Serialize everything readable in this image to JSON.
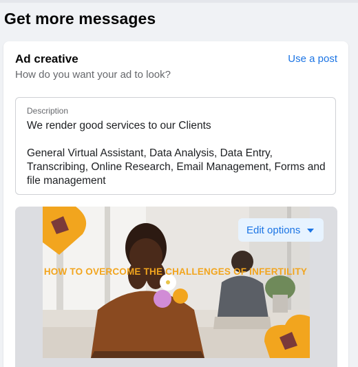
{
  "page": {
    "title": "Get more messages"
  },
  "ad_creative": {
    "title": "Ad creative",
    "subtitle": "How do you want your ad to look?",
    "use_post_link": "Use a post",
    "description": {
      "label": "Description",
      "value": "We render good services to our Clients\n\nGeneral Virtual Assistant, Data Analysis, Data Entry, Transcribing, Online Research, Email Management, Forms and file management"
    },
    "preview": {
      "edit_options_label": "Edit options",
      "creative_text": "HOW TO OVERCOME THE CHALLENGES OF INFERTILITY"
    }
  },
  "colors": {
    "accent": "#1b74e4",
    "accent_bg": "#e7f3ff",
    "creative_orange": "#f2a51e",
    "page_bg": "#f0f2f5"
  }
}
